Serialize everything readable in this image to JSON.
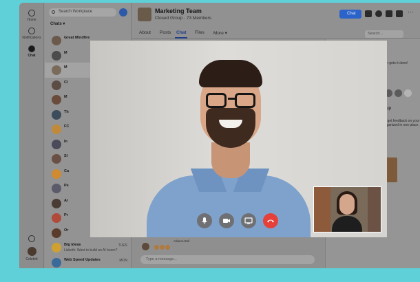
{
  "rail": {
    "items": [
      {
        "label": "Home",
        "icon": "home-icon"
      },
      {
        "label": "Notifications",
        "icon": "bell-icon"
      },
      {
        "label": "Chat",
        "icon": "chat-icon"
      }
    ],
    "bottom_label": "Celebrit"
  },
  "chatlist": {
    "search_placeholder": "Search Workplace",
    "heading": "Chats",
    "rows": [
      {
        "name": "Great Mindfire",
        "snippet": "",
        "time": ""
      },
      {
        "name": "M",
        "snippet": "",
        "time": ""
      },
      {
        "name": "M",
        "snippet": "",
        "time": ""
      },
      {
        "name": "Cl",
        "snippet": "",
        "time": ""
      },
      {
        "name": "M",
        "snippet": "",
        "time": ""
      },
      {
        "name": "Th",
        "snippet": "",
        "time": ""
      },
      {
        "name": "FC",
        "snippet": "",
        "time": ""
      },
      {
        "name": "In",
        "snippet": "",
        "time": ""
      },
      {
        "name": "Sl",
        "snippet": "",
        "time": ""
      },
      {
        "name": "Ca",
        "snippet": "",
        "time": ""
      },
      {
        "name": "Pe",
        "snippet": "",
        "time": ""
      },
      {
        "name": "Ar",
        "snippet": "",
        "time": ""
      },
      {
        "name": "Pr",
        "snippet": "",
        "time": ""
      },
      {
        "name": "Or",
        "snippet": "",
        "time": ""
      },
      {
        "name": "Big Ideas",
        "snippet": "Lisbeth: Want to build an AI boom?",
        "time": "TUES"
      },
      {
        "name": "Web Speed Updates",
        "snippet": "",
        "time": "MON"
      }
    ]
  },
  "header": {
    "group_name": "Marketing Team",
    "group_sub": "Closed Group · 73 Members",
    "chat_button": "Chat",
    "tabs": [
      "About",
      "Posts",
      "Chat",
      "Files",
      "More ▾"
    ],
    "search_placeholder": "Search..."
  },
  "conversation": {
    "reply_name": "Adaura Bell",
    "composer_placeholder": "Type a message..."
  },
  "right_panel": {
    "line1": "am gets it done!",
    "section": "oup",
    "desc1": "to get feedback on your",
    "desc2": "organized in one place."
  },
  "call": {
    "controls": [
      "mic",
      "camera",
      "screen-share",
      "end-call"
    ]
  },
  "colors": {
    "frame": "#5fd0d8",
    "accent": "#2b63c9",
    "end_call": "#e5403a"
  }
}
